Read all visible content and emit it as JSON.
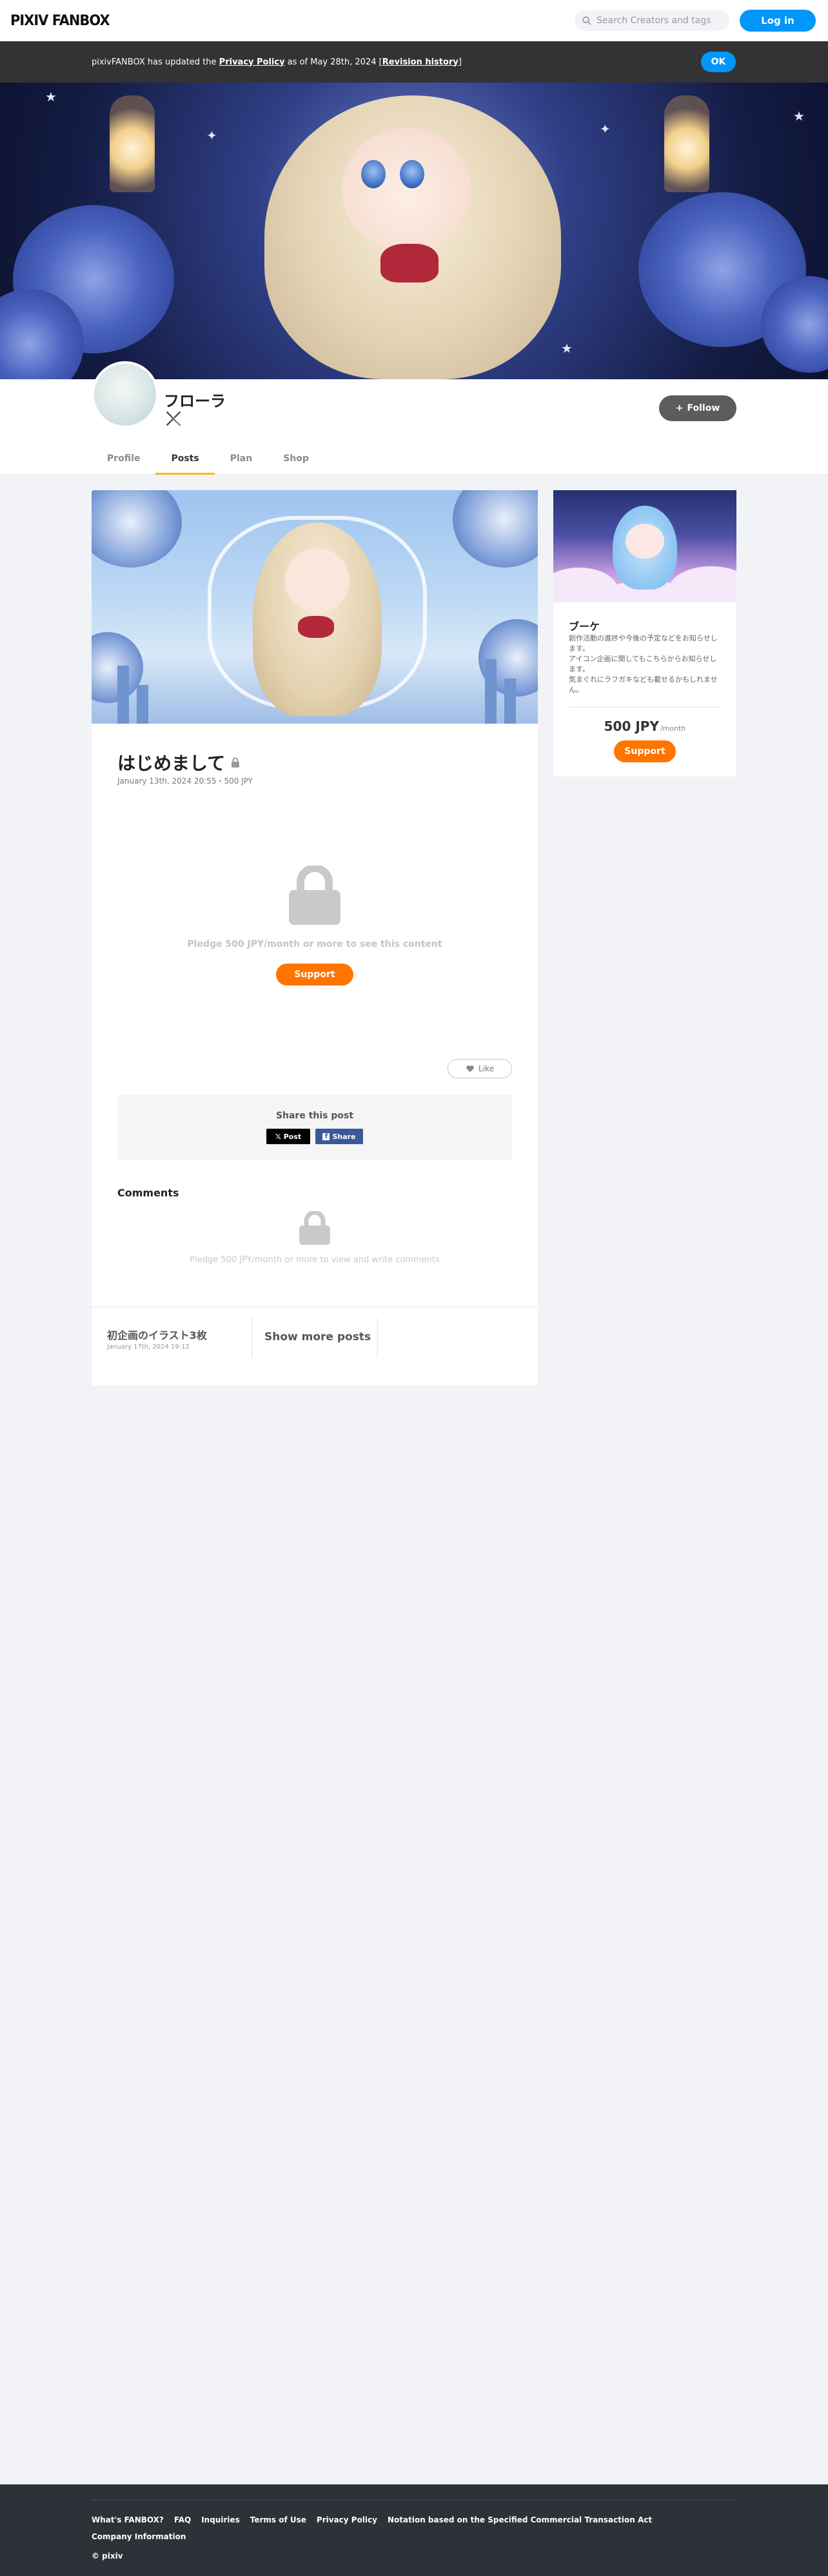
{
  "header": {
    "logo": "PIXIV FANBOX",
    "search_placeholder": "Search Creators and tags",
    "login_label": "Log in"
  },
  "notice": {
    "prefix": "pixivFANBOX has updated the ",
    "policy_link": "Privacy Policy",
    "middle": " as of May 28th, 2024 [",
    "revision_link": "Revision history",
    "suffix": "]",
    "ok_label": "OK"
  },
  "creator": {
    "name": "フローラ",
    "follow_label": "Follow",
    "tabs": [
      "Profile",
      "Posts",
      "Plan",
      "Shop"
    ],
    "active_tab": "Posts"
  },
  "post": {
    "title": "はじめまして",
    "meta": "January 13th, 2024 20:55・500 JPY",
    "locked_text": "Pledge 500 JPY/month or more to see this content",
    "support_label": "Support",
    "like_label": "Like",
    "share_title": "Share this post",
    "share_x_label": "Post",
    "share_fb_label": "Share",
    "comments_title": "Comments",
    "comments_locked_text": "Pledge 500 JPY/month or more to view and write comments",
    "next_post_title": "初企画のイラスト3枚",
    "next_post_date": "January 17th, 2024 19:12",
    "show_more_label": "Show more posts"
  },
  "plan": {
    "name": "ブーケ",
    "description": "創作活動の進捗や今後の予定などをお知らせします。\nアイコン企画に関してもこちらからお知らせします。\n気まぐれにラフガキなども載せるかもしれません。",
    "price": "500 JPY",
    "per": "/month",
    "support_label": "Support"
  },
  "footer": {
    "links": [
      "What's FANBOX?",
      "FAQ",
      "Inquiries",
      "Terms of Use",
      "Privacy Policy",
      "Notation based on the Specified Commercial Transaction Act",
      "Company Information"
    ],
    "copyright": "© pixiv"
  },
  "colors": {
    "accent_blue": "#0096fa",
    "support_orange": "#ff7500",
    "tab_underline": "#ffb60a",
    "footer_bg": "#2d3138"
  },
  "icons": [
    "search-icon",
    "lock-icon",
    "x-logo-icon",
    "plus-icon",
    "heart-icon",
    "facebook-icon"
  ]
}
